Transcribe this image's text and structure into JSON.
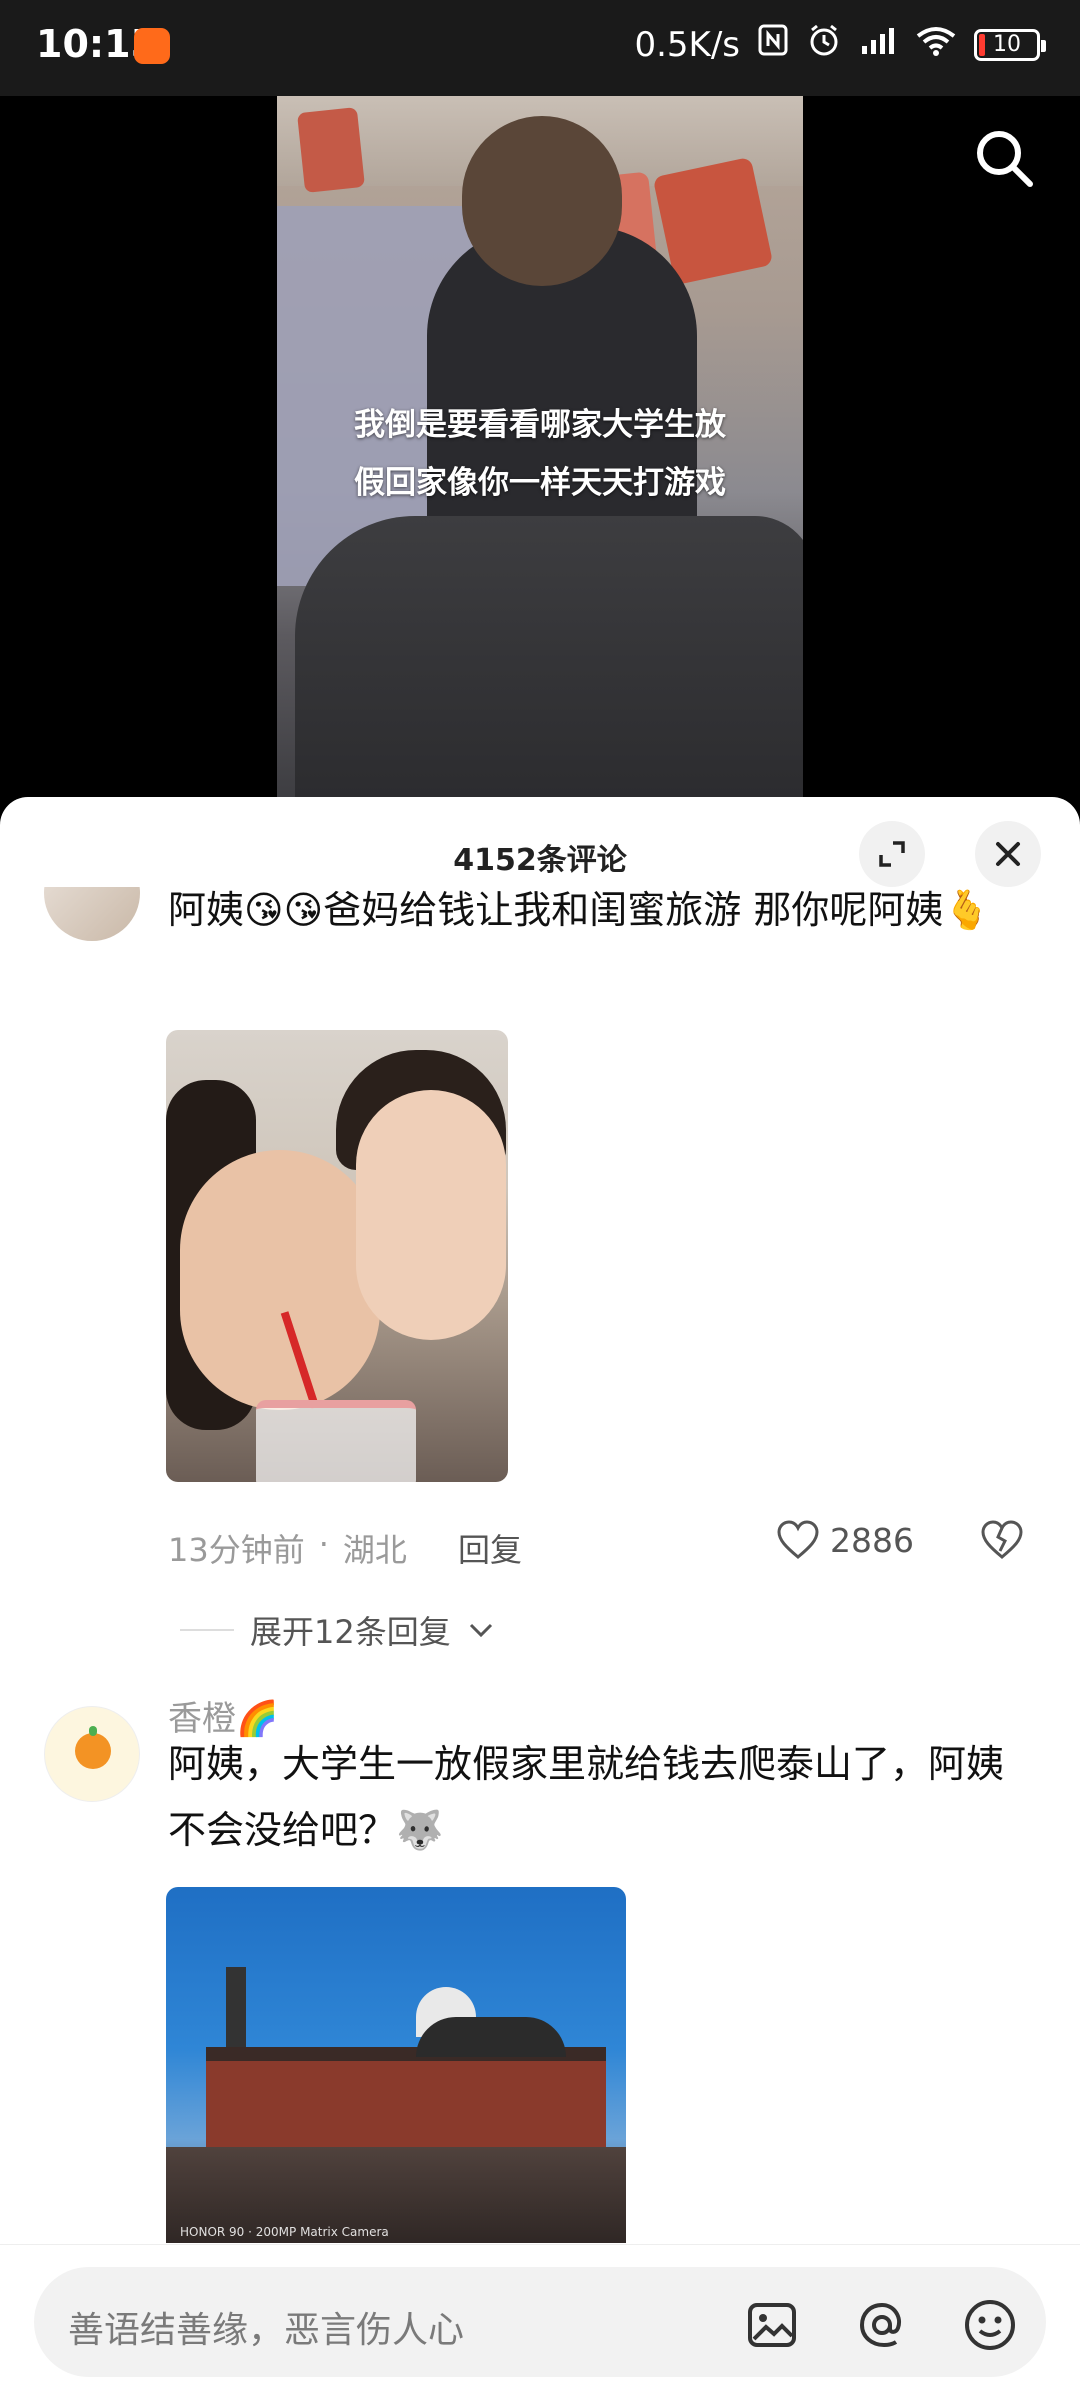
{
  "status_bar": {
    "time": "10:15",
    "net_speed": "0.5K/s",
    "battery": "10",
    "icons": [
      "nfc-icon",
      "alarm-icon",
      "signal-icon",
      "wifi-icon",
      "battery-icon"
    ]
  },
  "video": {
    "caption_line1": "我倒是要看看哪家大学生放",
    "caption_line2": "假回家像你一样天天打游戏"
  },
  "sheet": {
    "title": "4152条评论"
  },
  "comments": [
    {
      "text": "阿姨",
      "emoji_a": "😘😘",
      "text_b": "爸妈给钱让我和闺蜜旅游  那你呢阿姨",
      "emoji_b": "🫰",
      "time": "13分钟前",
      "location": "湖北",
      "reply_label": "回复",
      "likes": "2886",
      "expand_label": "展开12条回复"
    },
    {
      "name": "香橙",
      "name_emoji": "🌈",
      "text": "阿姨，大学生一放假家里就给钱去爬泰山了，阿姨不会没给吧？",
      "emoji": "🐺",
      "photo_watermark": "HONOR 90 · 200MP Matrix Camera"
    }
  ],
  "input": {
    "placeholder": "善语结善缘，恶言伤人心"
  },
  "colors": {
    "sheet_bg": "#ffffff",
    "muted_text": "#9a9a9a",
    "input_bg": "#f2f2f2"
  }
}
